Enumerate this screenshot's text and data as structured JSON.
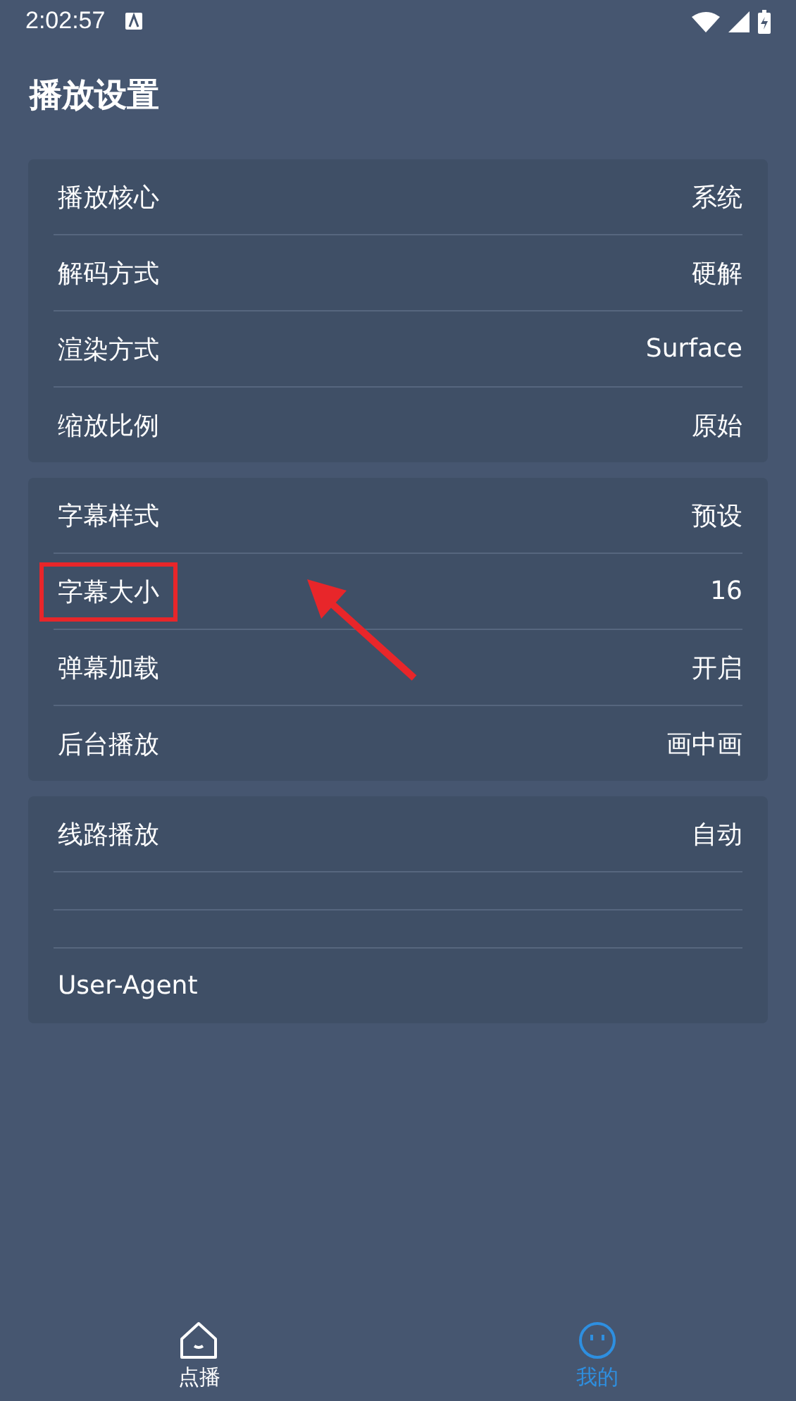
{
  "status_bar": {
    "time": "2:02:57"
  },
  "title": "播放设置",
  "groups": [
    {
      "rows": [
        {
          "kind": "setting",
          "label": "播放核心",
          "value": "系统",
          "highlighted": false
        },
        {
          "kind": "setting",
          "label": "解码方式",
          "value": "硬解",
          "highlighted": false
        },
        {
          "kind": "setting",
          "label": "渲染方式",
          "value": "Surface",
          "highlighted": false
        },
        {
          "kind": "setting",
          "label": "缩放比例",
          "value": "原始",
          "highlighted": false
        }
      ]
    },
    {
      "rows": [
        {
          "kind": "setting",
          "label": "字幕样式",
          "value": "预设",
          "highlighted": false
        },
        {
          "kind": "setting",
          "label": "字幕大小",
          "value": "16",
          "highlighted": true
        },
        {
          "kind": "setting",
          "label": "弹幕加载",
          "value": "开启",
          "highlighted": false
        },
        {
          "kind": "setting",
          "label": "后台播放",
          "value": "画中画",
          "highlighted": false
        }
      ]
    },
    {
      "rows": [
        {
          "kind": "setting",
          "label": "线路播放",
          "value": "自动",
          "highlighted": false
        },
        {
          "kind": "empty"
        },
        {
          "kind": "empty"
        },
        {
          "kind": "setting",
          "label": "User-Agent",
          "highlighted": false
        }
      ]
    }
  ],
  "nav": [
    {
      "label": "点播",
      "kind": "home",
      "selected": false
    },
    {
      "label": "我的",
      "kind": "profile",
      "selected": true
    }
  ]
}
